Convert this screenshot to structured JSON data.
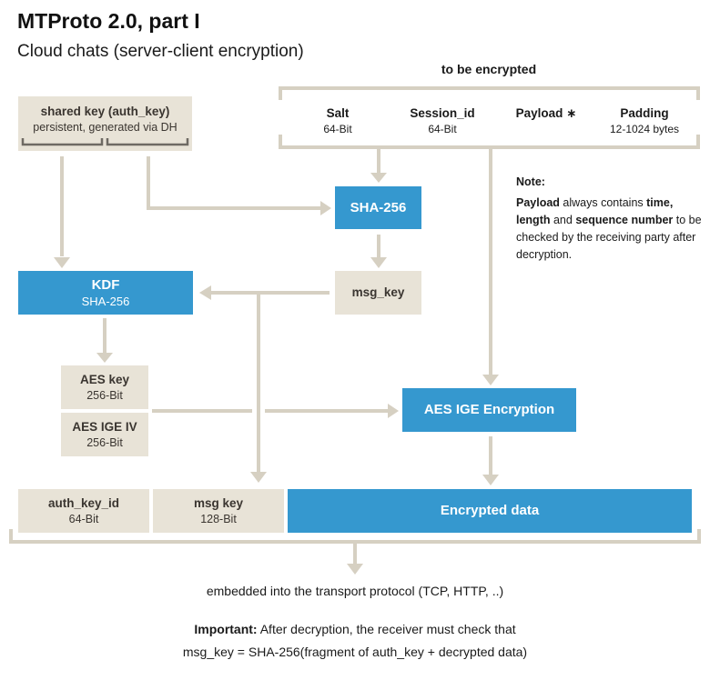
{
  "header": {
    "title": "MTProto 2.0, part I",
    "subtitle": "Cloud chats (server-client encryption)"
  },
  "colors": {
    "blue_box": "#3598cf",
    "beige_box": "#e8e3d7",
    "connector": "#d6d0c2",
    "bracket_dark": "#6e6a63"
  },
  "shared_key": {
    "title": "shared key (auth_key)",
    "subtitle": "persistent, generated via DH"
  },
  "to_be_encrypted": {
    "label": "to be encrypted",
    "fields": [
      {
        "title": "Salt",
        "subtitle": "64-Bit"
      },
      {
        "title": "Session_id",
        "subtitle": "64-Bit"
      },
      {
        "title": "Payload ∗",
        "subtitle": ""
      },
      {
        "title": "Padding",
        "subtitle": "12-1024 bytes"
      }
    ]
  },
  "note": {
    "heading": "Note:",
    "parts": {
      "p1": "Payload",
      "p2": " always contains ",
      "p3": "time,",
      "p4": "length",
      "p5": " and ",
      "p6": "sequence number",
      "p7": " to be checked by the receiving party after decryption."
    }
  },
  "boxes": {
    "sha256": {
      "title": "SHA-256"
    },
    "msg_key": {
      "title": "msg_key"
    },
    "kdf": {
      "title": "KDF",
      "subtitle": "SHA-256"
    },
    "aes_key": {
      "title": "AES key",
      "subtitle": "256-Bit"
    },
    "aes_iv": {
      "title": "AES IGE IV",
      "subtitle": "256-Bit"
    },
    "aes_enc": {
      "title": "AES IGE Encryption"
    }
  },
  "output_row": {
    "auth_key_id": {
      "title": "auth_key_id",
      "subtitle": "64-Bit"
    },
    "msg_key": {
      "title": "msg key",
      "subtitle": "128-Bit"
    },
    "encrypted": {
      "title": "Encrypted data"
    }
  },
  "footer": {
    "transport": "embedded into the transport protocol (TCP, HTTP, ..)",
    "important_label": "Important:",
    "important_text": " After decryption, the receiver must check that",
    "formula": "msg_key = SHA-256(fragment of auth_key + decrypted data)"
  }
}
